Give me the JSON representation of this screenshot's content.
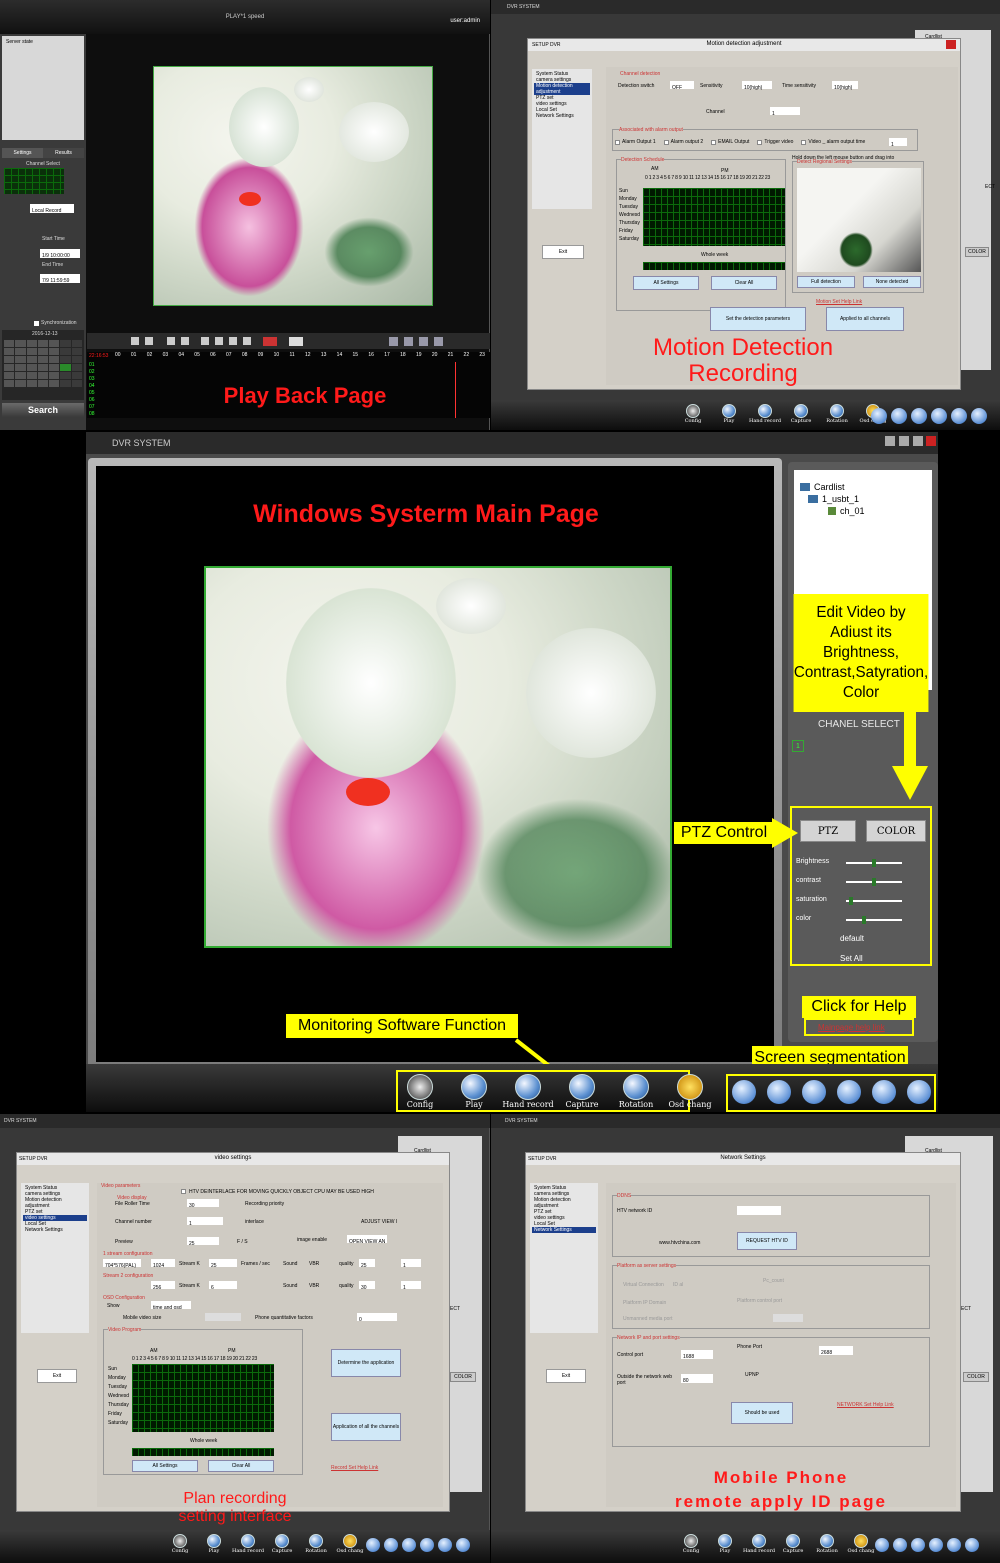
{
  "playback": {
    "title": "PLAY*1  speed",
    "user": "user:admin",
    "server_state": "Server state",
    "tabs": [
      "Settings",
      "Results"
    ],
    "channel_select": "Channel Select",
    "record_type": "Local Record",
    "start_time_label": "Start Time",
    "start_time": "1/9 10:00:00",
    "end_time_label": "End Time",
    "end_time": "7/9 11:59:59",
    "sync_label": "Synchronization",
    "calendar_month": "2016-12-13",
    "search_label": "Search",
    "timeline_hours": [
      "00",
      "01",
      "02",
      "03",
      "04",
      "05",
      "06",
      "07",
      "08",
      "09",
      "10",
      "11",
      "12",
      "13",
      "14",
      "15",
      "16",
      "17",
      "18",
      "19",
      "20",
      "21",
      "22",
      "23"
    ],
    "timeline_channels": [
      "01",
      "02",
      "03",
      "04",
      "05",
      "06",
      "07",
      "08"
    ],
    "time_readout": "22:16:53",
    "caption": "Play Back Page"
  },
  "motion": {
    "window_title": "DVR SYSTEM",
    "dialog_title": "Motion detection adjustment",
    "setup_label": "SETUP   DVR",
    "menu": [
      "System Status",
      "camera settings",
      "Motion detection adjustment",
      "PTZ set",
      "video settings",
      "Local Set",
      "Network Settings"
    ],
    "exit": "Exit",
    "channel_detection": "Channel detection",
    "detection_switch": "Detection switch",
    "detection_switch_val": "OFF",
    "sensitivity": "Sensitivity",
    "sensitivity_val": "10(high)",
    "time_sensitivity": "Time sensitivity",
    "time_sensitivity_val": "10(high)",
    "channel": "Channel",
    "channel_val": "1",
    "assoc_alarm": "Associated with alarm output",
    "alarm_outputs": [
      "Alarm Output 1",
      "Alarm output 2",
      "EMAIL Output",
      "Trigger video",
      "Video _ alarm output time"
    ],
    "alarm_time_val": "1",
    "detection_schedule": "Detection Schedule",
    "am": "AM",
    "pm": "PM",
    "hours": "0 1 2 3 4 5 6 7 8 9 10 11 12 13 14 15 16 17 18 19 20 21 22 23",
    "days": [
      "Sun",
      "Monday",
      "Tuesday",
      "Wednesd",
      "Thursday",
      "Friday",
      "Saturday"
    ],
    "whole_week": "Whole week",
    "all_settings": "All Settings",
    "clear_all": "Clear All",
    "hold_text": "Hold down the left mouse button and drag into",
    "detect_region": "Detect Regional Settings",
    "full_detection": "Full detection",
    "none_detected": "None detected",
    "help_link": "Motion Set Help Link",
    "set_params": "Set the detection parameters",
    "applied_all": "Applied to all channels",
    "cardlist": "Cardlist",
    "ect": "ECT",
    "color": "COLOR",
    "caption_line1": "Motion Detection",
    "caption_line2": "Recording"
  },
  "main": {
    "window_title": "DVR SYSTEM",
    "caption": "Windows Systerm Main Page",
    "cardlist": "Cardlist",
    "device": "1_usbt_1",
    "channel_node": "ch_01",
    "edit_video": "Edit Video by Adiust its Brightness, Contrast,Satyration, Color",
    "chanel_select": "CHANEL SELECT",
    "chanel_num": "1",
    "ptz": "PTZ",
    "color": "COLOR",
    "ptz_control": "PTZ Control",
    "sliders": [
      {
        "label": "Brightness",
        "value": 0.5
      },
      {
        "label": "contrast",
        "value": 0.5
      },
      {
        "label": "saturation",
        "value": 0.05
      },
      {
        "label": "color",
        "value": 0.3
      }
    ],
    "default": "default",
    "set_all": "Set All",
    "click_help": "Click for Help",
    "help_link": "Mainpage help link",
    "monitoring": "Monitoring Software Function",
    "screen_seg": "Screen segmentation",
    "toolbar": [
      "Config",
      "Play",
      "Hand record",
      "Capture",
      "Rotation",
      "Osd chang"
    ]
  },
  "video": {
    "window_title": "DVR SYSTEM",
    "dialog_title": "video settings",
    "setup_label": "SETUP   DVR",
    "menu": [
      "System Status",
      "camera settings",
      "Motion detection adjustment",
      "PTZ set",
      "video settings",
      "Local Set",
      "Network Settings"
    ],
    "exit": "Exit",
    "video_params": "Video parameters",
    "htv_note": "HTV DEINTERLACE FOR MOVING QUICKLY OBJECT CPU MAY BE USED HIGH",
    "video_display": "Video display",
    "file_roller_time": "File Roller Time",
    "file_roller_val": "30",
    "recording_priority": "Recording priority",
    "channel_number": "Channel number",
    "channel_number_val": "1",
    "interlace": "interlace",
    "adjust_view": "ADJUST VIEW I",
    "preview": "Preview",
    "preview_val": "25",
    "fs": "F / S",
    "image_enable": "image enable",
    "image_enable_val": "OPEN VIEW AN",
    "stream1": "1 stream configuration",
    "stream1_res": "704*576(PAL)",
    "stream1_k": "1024",
    "stream_k": "Stream K",
    "fps_val": "25",
    "frames_sec": "Frames / sec",
    "sound": "Sound",
    "vbr": "VBR",
    "quality": "quality",
    "quality1": "25",
    "q1": "1",
    "stream2": "Stream 2 configuration",
    "stream2_k": "256",
    "fps2_val": "6",
    "quality2": "30",
    "q2": "1",
    "osd": "OSD Configuration",
    "show": "Show",
    "show_val": "time and osd",
    "mobile_size": "Mobile video size",
    "phone_factor": "Phone quantitative factors",
    "phone_factor_val": "0",
    "video_program": "Video Program",
    "am": "AM",
    "pm": "PM",
    "hours": "0 1 2 3 4 5 6 7 8 9 10 11 12 13 14 15 16 17 18 19 20 21 22 23",
    "days": [
      "Sun",
      "Monday",
      "Tuesday",
      "Wednesd",
      "Thursday",
      "Friday",
      "Saturday"
    ],
    "whole_week": "Whole week",
    "all_settings": "All Settings",
    "clear_all": "Clear All",
    "determine": "Determine the application",
    "apply_all": "Application of all the channels",
    "help_link": "Record Set Help Link",
    "cardlist": "Cardlist",
    "ect": "ECT",
    "color": "COLOR",
    "caption_line1": "Plan recording",
    "caption_line2": "setting interface"
  },
  "network": {
    "window_title": "DVR SYSTEM",
    "dialog_title": "Network Settings",
    "setup_label": "SETUP   DVR",
    "menu": [
      "System Status",
      "camera settings",
      "Motion detection adjustment",
      "PTZ set",
      "video settings",
      "Local Set",
      "Network Settings"
    ],
    "exit": "Exit",
    "ddns": "DDNS",
    "htv_id": "HTV network ID",
    "url": "www.htvchina.com",
    "request": "REQUEST HTV ID",
    "platform": "Platform as server settings",
    "virtual_connection": "Virtual Connection",
    "ip_text": "ID al",
    "pc_count": "Pc_count",
    "platform_ip": "Platform IP Domain",
    "platform_control": "Platform control port",
    "unmanned": "Unmanned media port",
    "network_ip": "Network IP and port settings",
    "control_port": "Control port",
    "control_port_val": "1688",
    "phone_port": "Phone Port",
    "phone_port_val": "2688",
    "upnp": "UPNP",
    "outside_web": "Outside the network web port",
    "outside_val": "80",
    "should_used": "Should be used",
    "help_link": "NETWORK Set Help Link",
    "cardlist": "Cardlist",
    "ect": "ECT",
    "color": "COLOR",
    "caption_line1": "Mobile Phone",
    "caption_line2": "remote apply ID page"
  }
}
